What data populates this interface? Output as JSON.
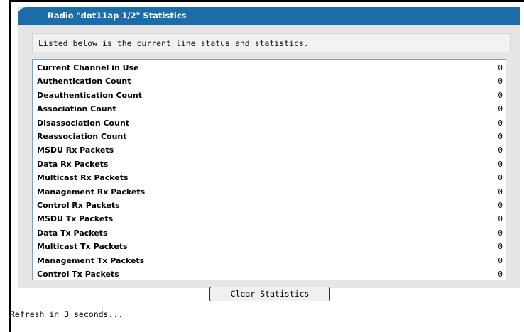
{
  "panel": {
    "title": "Radio \"dot11ap 1/2\" Statistics",
    "description": "Listed below is the current line status and statistics."
  },
  "stats": [
    {
      "label": "Current Channel in Use",
      "value": "0"
    },
    {
      "label": "Authentication Count",
      "value": "0"
    },
    {
      "label": "Deauthentication Count",
      "value": "0"
    },
    {
      "label": "Association Count",
      "value": "0"
    },
    {
      "label": "Disassociation Count",
      "value": "0"
    },
    {
      "label": "Reassociation Count",
      "value": "0"
    },
    {
      "label": "MSDU Rx Packets",
      "value": "0"
    },
    {
      "label": "Data Rx Packets",
      "value": "0"
    },
    {
      "label": "Multicast Rx Packets",
      "value": "0"
    },
    {
      "label": "Management Rx Packets",
      "value": "0"
    },
    {
      "label": "Control Rx Packets",
      "value": "0"
    },
    {
      "label": "MSDU Tx Packets",
      "value": "0"
    },
    {
      "label": "Data Tx Packets",
      "value": "0"
    },
    {
      "label": "Multicast Tx Packets",
      "value": "0"
    },
    {
      "label": "Management Tx Packets",
      "value": "0"
    },
    {
      "label": "Control Tx Packets",
      "value": "0"
    }
  ],
  "actions": {
    "clear_label": "Clear Statistics"
  },
  "footer": {
    "refresh_text": "Refresh in 3 seconds..."
  },
  "colors": {
    "header_bg": "#1a6da8",
    "panel_bg": "#e6e6e6",
    "table_border": "#7fa2c6"
  }
}
